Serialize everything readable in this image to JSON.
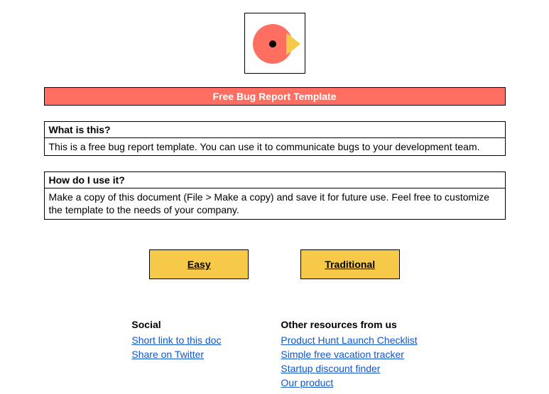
{
  "title": "Free Bug Report Template",
  "sections": [
    {
      "heading": "What is this?",
      "body": "This is a free bug report template. You can use it to communicate bugs to your development team."
    },
    {
      "heading": "How do I use it?",
      "body": "Make a copy of this document (File > Make a copy) and save it for future use. Feel free to customize the template to the needs of your company."
    }
  ],
  "buttons": {
    "easy": "Easy",
    "traditional": "Traditional"
  },
  "footer": {
    "social": {
      "heading": "Social",
      "links": [
        "Short link to this doc",
        "Share on Twitter"
      ]
    },
    "resources": {
      "heading": "Other resources from us",
      "links": [
        "Product Hunt Launch Checklist",
        "Simple free vacation tracker",
        "Startup discount finder",
        "Our product"
      ]
    }
  },
  "colors": {
    "accent": "#ff6f61",
    "button": "#f7c948",
    "link": "#1155cc"
  }
}
